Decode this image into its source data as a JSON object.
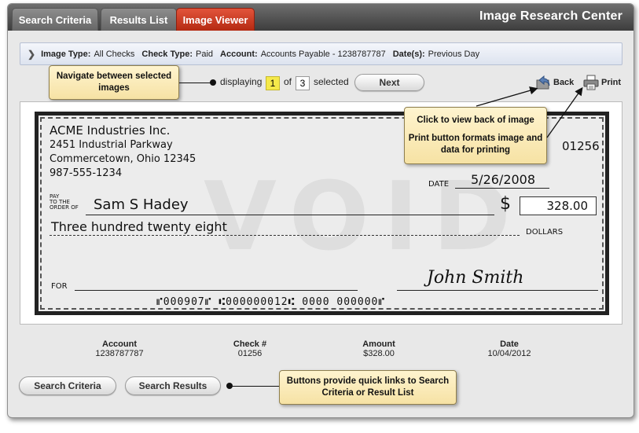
{
  "tabs": [
    {
      "label": "Search Criteria",
      "active": false
    },
    {
      "label": "Results List",
      "active": false
    },
    {
      "label": "Image Viewer",
      "active": true
    }
  ],
  "app_title": "Image Research Center",
  "criteria": {
    "image_type_label": "Image Type:",
    "image_type": "All Checks",
    "check_type_label": "Check Type:",
    "check_type": "Paid",
    "account_label": "Account:",
    "account": "Accounts Payable - 1238787787",
    "dates_label": "Date(s):",
    "dates": "Previous Day"
  },
  "callouts": {
    "navigate": "Navigate between selected images",
    "back_print_1": "Click to view back of image",
    "back_print_2": "Print button formats image and data for printing",
    "buttons": "Buttons provide quick links to Search Criteria or Result List"
  },
  "nav": {
    "displaying": "displaying",
    "current": "1",
    "of": "of",
    "total": "3",
    "selected": "selected",
    "next_label": "Next",
    "back_label": "Back",
    "print_label": "Print"
  },
  "check": {
    "company": "ACME Industries Inc.",
    "address1": "2451 Industrial Parkway",
    "address2": "Commercetown, Ohio 12345",
    "phone": "987-555-1234",
    "number": "01256",
    "date_label": "DATE",
    "date": "5/26/2008",
    "pay_label_1": "PAY",
    "pay_label_2": "TO THE",
    "pay_label_3": "ORDER OF",
    "payee": "Sam S Hadey",
    "dollar_sign": "$",
    "amount": "328.00",
    "amount_words": "Three hundred twenty eight",
    "dollars_label": "DOLLARS",
    "for_label": "FOR",
    "signature": "John Smith",
    "micr": "⑈000907⑈ ⑆000000012⑆ 0000 000000⑈",
    "watermark": "VOID"
  },
  "details": [
    {
      "label": "Account",
      "value": "1238787787"
    },
    {
      "label": "Check #",
      "value": "01256"
    },
    {
      "label": "Amount",
      "value": "$328.00"
    },
    {
      "label": "Date",
      "value": "10/04/2012"
    }
  ],
  "footer": {
    "search_criteria_label": "Search Criteria",
    "search_results_label": "Search Results"
  },
  "colors": {
    "active_tab": "#c83a20",
    "callout": "#fbecb8",
    "highlight": "#f5e94a"
  }
}
